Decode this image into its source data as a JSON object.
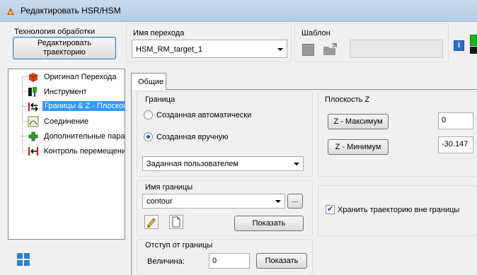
{
  "window": {
    "title": "Редактировать HSR/HSM"
  },
  "tech": {
    "label": "Технология обработки",
    "edit_button": "Редактировать траекторию"
  },
  "transition": {
    "label": "Имя перехода",
    "value": "HSM_RM_target_1"
  },
  "template": {
    "label": "Шаблон",
    "value": ""
  },
  "tree": {
    "items": [
      {
        "label": "Оригинал Перехода",
        "icon": "original-transition-icon"
      },
      {
        "label": "Инструмент",
        "icon": "tool-icon"
      },
      {
        "label": "Границы & Z - Плоскость",
        "icon": "boundary-z-icon",
        "selected": true
      },
      {
        "label": "Соединение",
        "icon": "connection-icon"
      },
      {
        "label": "Дополнительные параметры",
        "icon": "additional-params-icon"
      },
      {
        "label": "Контроль перемещения",
        "icon": "motion-control-icon"
      }
    ]
  },
  "tabs": [
    {
      "label": "Общие"
    }
  ],
  "boundary": {
    "label": "Граница",
    "auto_label": "Созданная автоматически",
    "manual_label": "Созданная вручную",
    "selected": "manual",
    "type_value": "Заданная пользователем"
  },
  "zplane": {
    "label": "Плоскость Z",
    "max_button": "Z - Максимум",
    "max_value": "0",
    "min_button": "Z - Минимум",
    "min_value": "-30.147"
  },
  "boundary_name": {
    "label": "Имя границы",
    "value": "contour",
    "browse_label": "...",
    "show_button": "Показать"
  },
  "keep_outside": {
    "label": "Хранить траекторию вне границы",
    "checked": true
  },
  "offset": {
    "label": "Отступ от границы",
    "value_label": "Величина:",
    "value": "0",
    "show_button": "Показать"
  },
  "colors": {
    "accent": "#3399ff",
    "title_bar": "#c9dbee",
    "status_green": "#1fb21f",
    "info_blue": "#2a6fc9"
  }
}
